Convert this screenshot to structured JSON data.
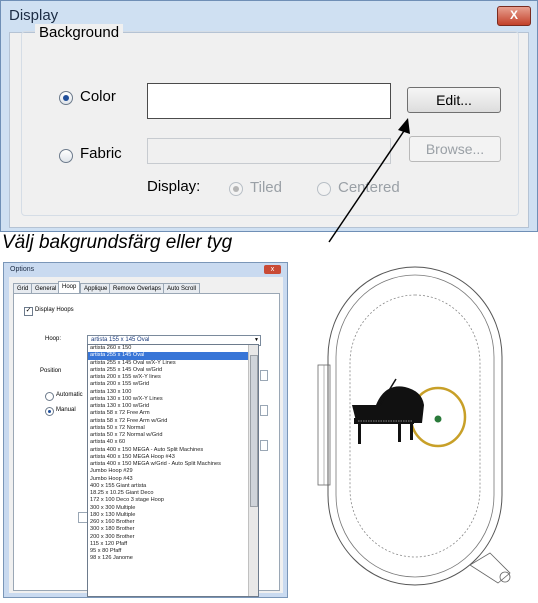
{
  "display_dialog": {
    "title": "Display",
    "close_label": "X",
    "group_label": "Background",
    "color_option": "Color",
    "fabric_option": "Fabric",
    "edit_button": "Edit...",
    "browse_button": "Browse...",
    "display_label": "Display:",
    "tiled_option": "Tiled",
    "centered_option": "Centered"
  },
  "caption": "Välj bakgrundsfärg eller tyg",
  "options_dialog": {
    "title": "Options",
    "tabs": [
      "Grid",
      "General",
      "Hoop",
      "Applique",
      "Remove Overlaps",
      "Auto Scroll"
    ],
    "display_hoops": "Display Hoops",
    "hoop_label": "Hoop:",
    "selected_hoop": "artista 155 x 145 Oval",
    "position_label": "Position",
    "automatic": "Automatic",
    "manual": "Manual",
    "hoop_list": [
      "artista 260 x 150",
      "artista 255 x 145 Oval",
      "artista 255 x 145 Oval w/X-Y Lines",
      "artista 255 x 145 Oval w/Grid",
      "artista 200 x 155 w/X-Y lines",
      "artista 200 x 155 w/Grid",
      "artista 130 x 100",
      "artista 130 x 100 w/X-Y Lines",
      "artista 130 x 100 w/Grid",
      "artista 58 x 72 Free Arm",
      "artista 58 x 72 Free Arm w/Grid",
      "artista 50 x 72 Normal",
      "artista 50 x 72 Normal w/Grid",
      "artista 40 x 60",
      "artista 400 x 150 MEGA - Auto Split Machines",
      "artista 400 x 150 MEGA Hoop #43",
      "artista 400 x 150 MEGA w/Grid - Auto Split Machines",
      "Jumbo Hoop #29",
      "Jumbo Hoop #43",
      "400 x 155 Giant artista",
      "18.25 x 10.25 Giant Deco",
      "172 x 100 Deco 3 stage Hoop",
      "300 x 300 Multiple",
      "180 x 130 Multiple",
      "260 x 160 Brother",
      "300 x 180 Brother",
      "200 x 300 Brother",
      "115 x 120 Pfaff",
      "95 x 80 Pfaff",
      "98 x 126 Janome"
    ],
    "selected_index": 1
  }
}
